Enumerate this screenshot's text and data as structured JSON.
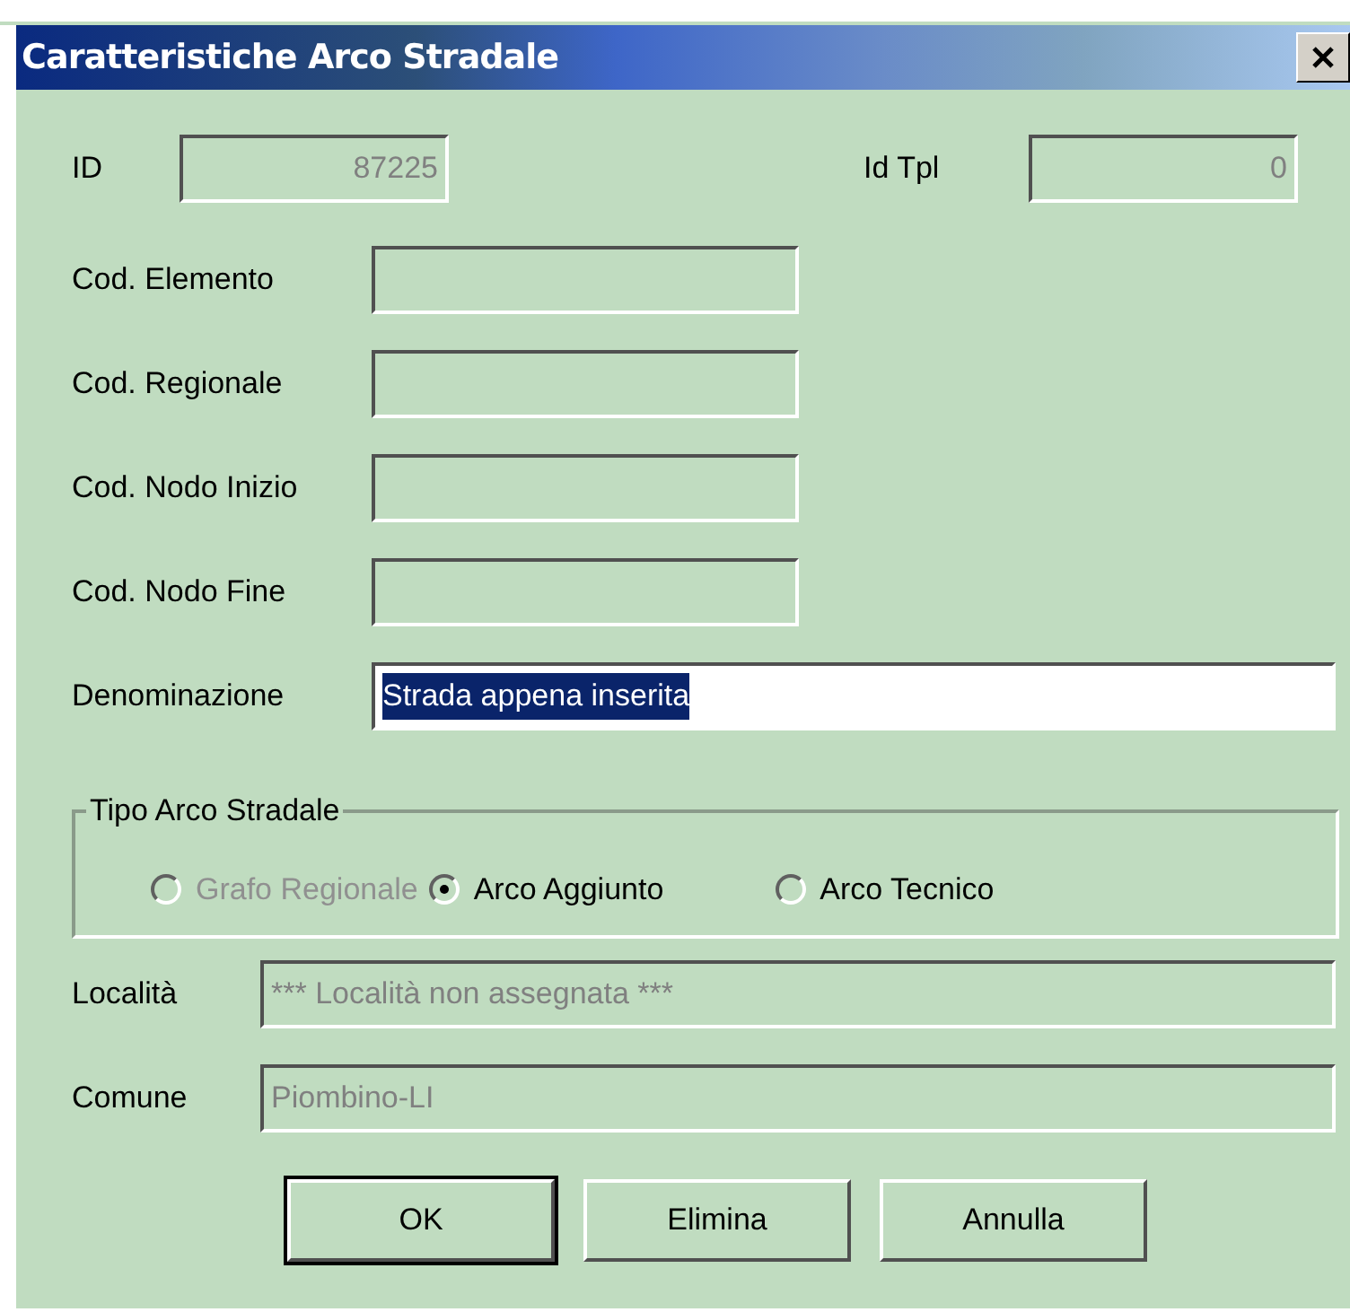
{
  "window": {
    "title": "Caratteristiche Arco Stradale"
  },
  "id_row": [
    {
      "label": "ID",
      "value": "87225",
      "disabled": true
    },
    {
      "label": "Id Tpl",
      "value": "0",
      "disabled": true
    }
  ],
  "code_fields": [
    {
      "label": "Cod. Elemento",
      "disabled": true
    },
    {
      "label": "Cod. Regionale",
      "disabled": true
    },
    {
      "label": "Cod. Nodo Inizio",
      "disabled": true
    },
    {
      "label": "Cod. Nodo Fine",
      "disabled": true
    }
  ],
  "name_field": {
    "label": "Denominazione",
    "value": "Strada appena inserita",
    "disabled": false,
    "text_selected": true
  },
  "type_group": {
    "title": "Tipo Arco Stradale",
    "options": [
      {
        "label": "Grafo Regionale",
        "selected": false,
        "disabled": true
      },
      {
        "label": "Arco Aggiunto",
        "selected": true,
        "disabled": false
      },
      {
        "label": "Arco Tecnico",
        "selected": false,
        "disabled": false
      }
    ]
  },
  "place_fields": [
    {
      "label": "Località",
      "value": "*** Località non assegnata ***",
      "disabled": true
    },
    {
      "label": "Comune",
      "value": "Piombino-LI",
      "disabled": true
    }
  ],
  "buttons": [
    {
      "label": "OK",
      "default": true
    },
    {
      "label": "Elimina",
      "default": false
    },
    {
      "label": "Annulla",
      "default": false
    }
  ]
}
